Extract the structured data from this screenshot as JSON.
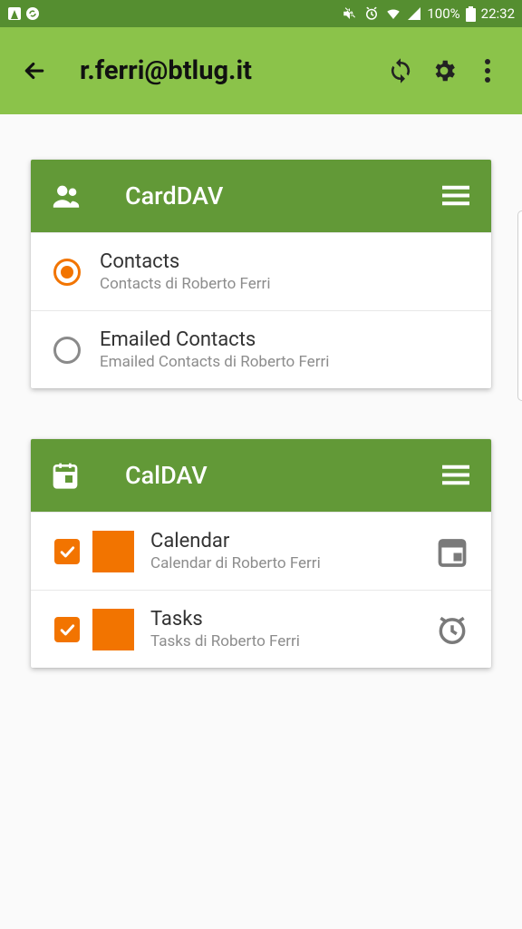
{
  "statusbar": {
    "battery_text": "100%",
    "time": "22:32"
  },
  "appbar": {
    "title": "r.ferri@btlug.it"
  },
  "carddav": {
    "title": "CardDAV",
    "items": [
      {
        "title": "Contacts",
        "subtitle": "Contacts di Roberto Ferri",
        "selected": true
      },
      {
        "title": "Emailed Contacts",
        "subtitle": "Emailed Contacts di Roberto Ferri",
        "selected": false
      }
    ]
  },
  "caldav": {
    "title": "CalDAV",
    "items": [
      {
        "title": "Calendar",
        "subtitle": "Calendar di Roberto Ferri",
        "checked": true,
        "color": "#f27400",
        "trail": "calendar"
      },
      {
        "title": "Tasks",
        "subtitle": "Tasks di Roberto Ferri",
        "checked": true,
        "color": "#f27400",
        "trail": "alarm"
      }
    ]
  }
}
